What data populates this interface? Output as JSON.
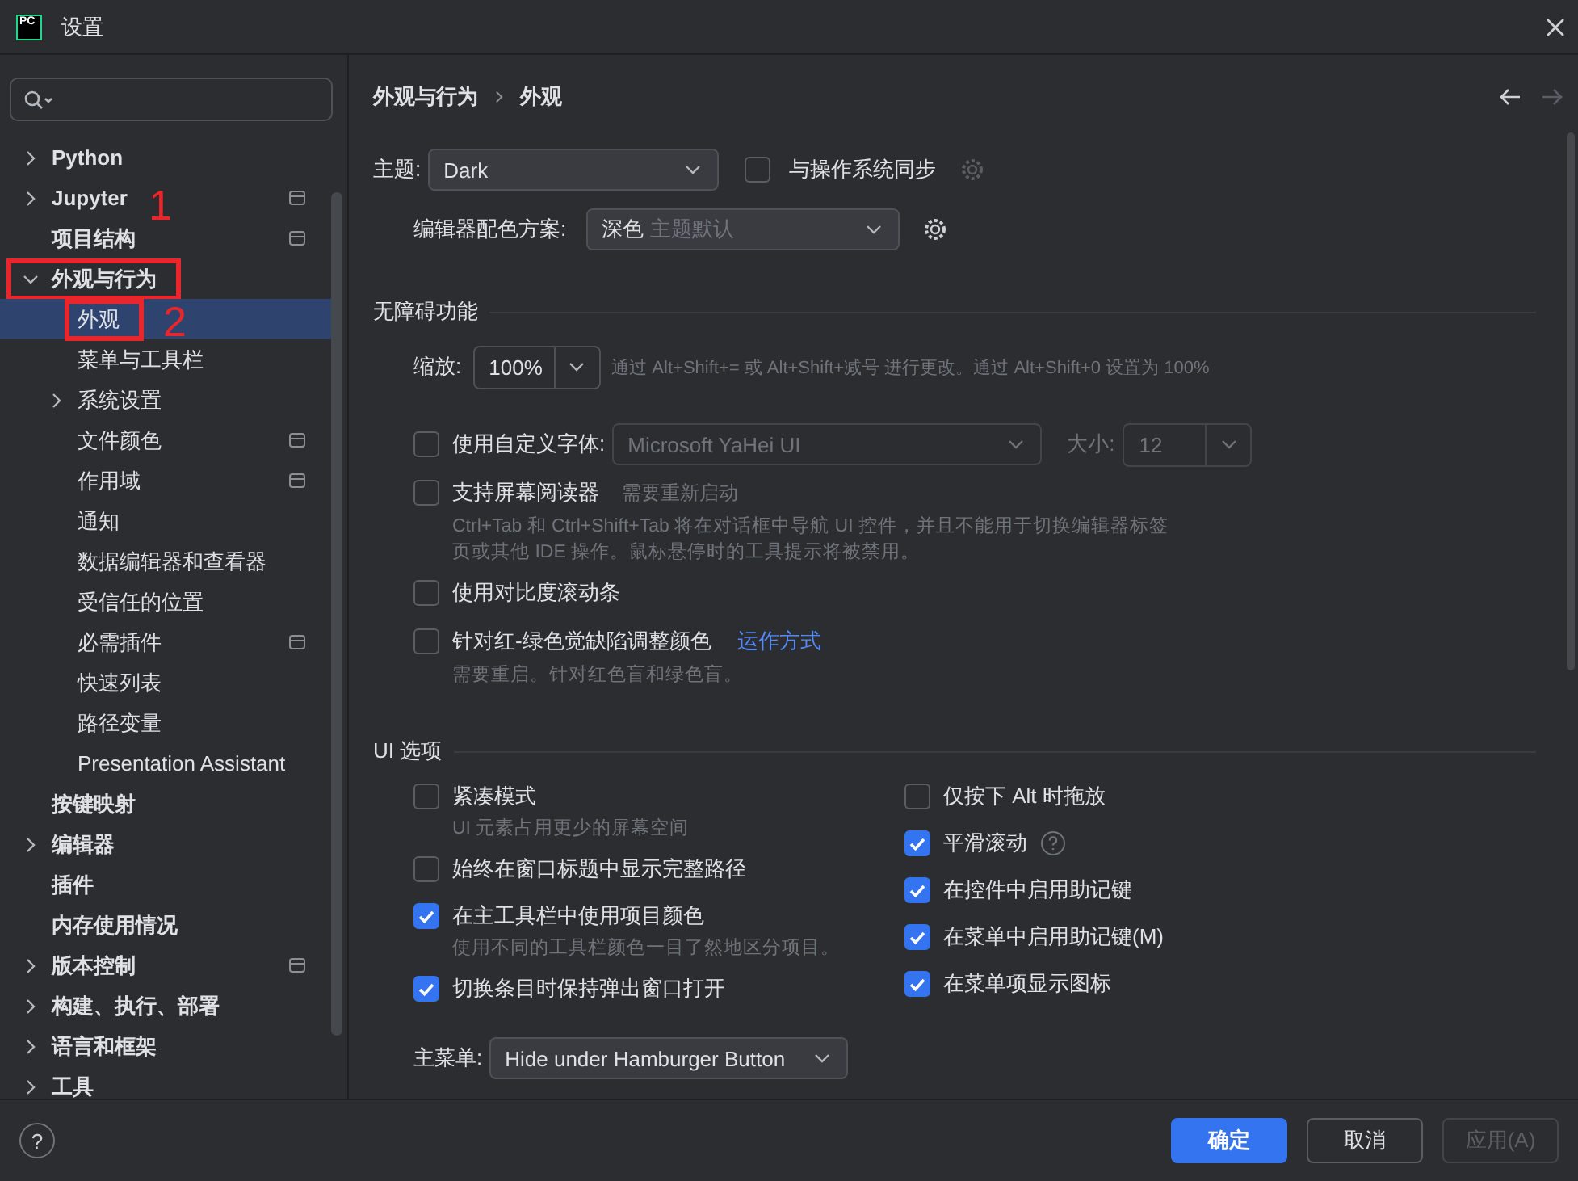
{
  "window": {
    "title": "设置",
    "logo_text": "PC"
  },
  "sidebar": {
    "items": [
      {
        "label": "Python",
        "expanded": false,
        "selected": false
      },
      {
        "label": "Jupyter",
        "expanded": false,
        "project_scope": true,
        "selected": false
      },
      {
        "label": "项目结构",
        "project_scope": true,
        "selected": false
      },
      {
        "label": "外观与行为",
        "expanded": true,
        "selected": false,
        "annotation": "1",
        "children": [
          {
            "label": "外观",
            "selected": true,
            "annotation": "2"
          },
          {
            "label": "菜单与工具栏",
            "selected": false
          },
          {
            "label": "系统设置",
            "expanded": false,
            "selected": false
          },
          {
            "label": "文件颜色",
            "project_scope": true,
            "selected": false
          },
          {
            "label": "作用域",
            "project_scope": true,
            "selected": false
          },
          {
            "label": "通知",
            "selected": false
          },
          {
            "label": "数据编辑器和查看器",
            "selected": false
          },
          {
            "label": "受信任的位置",
            "selected": false
          },
          {
            "label": "必需插件",
            "project_scope": true,
            "selected": false
          },
          {
            "label": "快速列表",
            "selected": false
          },
          {
            "label": "路径变量",
            "selected": false
          },
          {
            "label": "Presentation Assistant",
            "selected": false
          }
        ]
      },
      {
        "label": "按键映射",
        "selected": false
      },
      {
        "label": "编辑器",
        "expanded": false,
        "selected": false
      },
      {
        "label": "插件",
        "selected": false
      },
      {
        "label": "内存使用情况",
        "selected": false
      },
      {
        "label": "版本控制",
        "expanded": false,
        "project_scope": true,
        "selected": false
      },
      {
        "label": "构建、执行、部署",
        "expanded": false,
        "selected": false
      },
      {
        "label": "语言和框架",
        "expanded": false,
        "selected": false
      },
      {
        "label": "工具",
        "expanded": false,
        "selected": false
      }
    ]
  },
  "breadcrumb": [
    "外观与行为",
    "外观"
  ],
  "nav": {
    "back": {
      "disabled": false
    },
    "forward": {
      "disabled": true
    }
  },
  "theme": {
    "label": "主题:",
    "value": "Dark",
    "sync": {
      "label": "与操作系统同步",
      "checked": false
    }
  },
  "scheme": {
    "label": "编辑器配色方案:",
    "value": "深色",
    "hint": "主题默认"
  },
  "accessibility": {
    "title": "无障碍功能",
    "zoom": {
      "label": "缩放:",
      "value": "100%",
      "hint": "通过 Alt+Shift+= 或 Alt+Shift+减号 进行更改。通过 Alt+Shift+0 设置为 100%"
    },
    "options": [
      {
        "kind": "font",
        "label": "使用自定义字体:",
        "checked": false,
        "font_value": "Microsoft YaHei UI",
        "size_label": "大小:",
        "size_value": "12"
      },
      {
        "kind": "check",
        "label": "支持屏幕阅读器",
        "checked": false,
        "note": "需要重新启动",
        "description": "Ctrl+Tab 和 Ctrl+Shift+Tab 将在对话框中导航 UI 控件，并且不能用于切换编辑器标签页或其他 IDE 操作。鼠标悬停时的工具提示将被禁用。"
      },
      {
        "kind": "check",
        "label": "使用对比度滚动条",
        "checked": false
      },
      {
        "kind": "check",
        "label": "针对红-绿色觉缺陷调整颜色",
        "checked": false,
        "link": "运作方式",
        "description": "需要重启。针对红色盲和绿色盲。"
      }
    ]
  },
  "ui_options": {
    "title": "UI 选项",
    "left": [
      {
        "label": "紧凑模式",
        "checked": false,
        "description": "UI 元素占用更少的屏幕空间"
      },
      {
        "label": "始终在窗口标题中显示完整路径",
        "checked": false
      },
      {
        "label": "在主工具栏中使用项目颜色",
        "checked": true,
        "description": "使用不同的工具栏颜色一目了然地区分项目。"
      },
      {
        "label": "切换条目时保持弹出窗口打开",
        "checked": true
      }
    ],
    "right": [
      {
        "label": "仅按下 Alt 时拖放",
        "checked": false
      },
      {
        "label": "平滑滚动",
        "checked": true,
        "help": true
      },
      {
        "label": "在控件中启用助记键",
        "checked": true
      },
      {
        "label": "在菜单中启用助记键(M)",
        "checked": true
      },
      {
        "label": "在菜单项显示图标",
        "checked": true
      }
    ],
    "main_menu": {
      "label": "主菜单:",
      "value": "Hide under Hamburger Button"
    }
  },
  "footer": {
    "help": "?",
    "buttons": [
      {
        "label": "确定",
        "kind": "primary",
        "disabled": false
      },
      {
        "label": "取消",
        "kind": "normal",
        "disabled": false
      },
      {
        "label": "应用(A)",
        "kind": "normal",
        "disabled": true
      }
    ]
  }
}
